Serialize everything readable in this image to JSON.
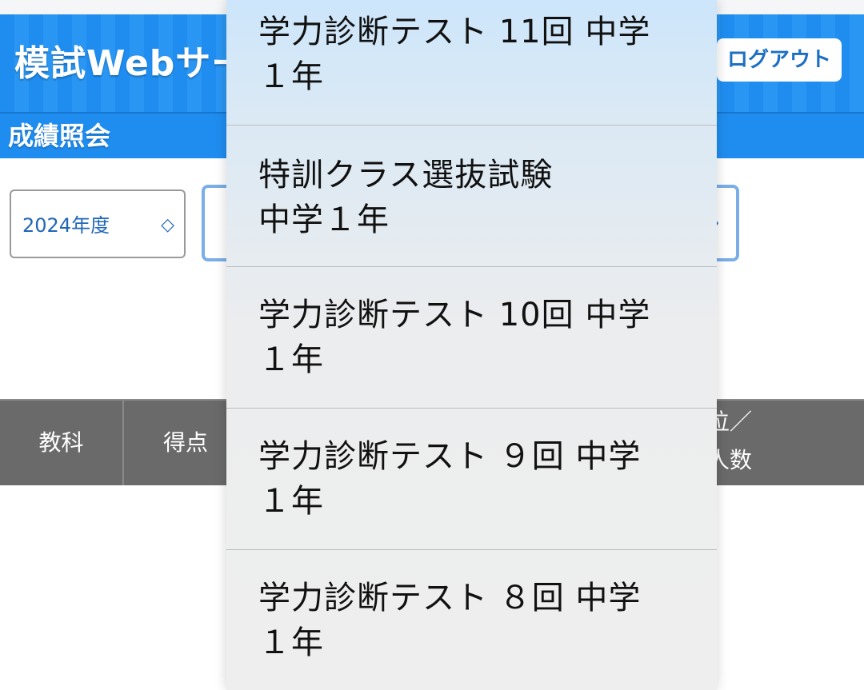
{
  "header": {
    "app_title": "模試Webサー",
    "logout_label": "ログアウト"
  },
  "subbar": {
    "title": "成績照会"
  },
  "filters": {
    "year_value": "2024年度",
    "year_chevron": "◇",
    "exam_chevron": "〉"
  },
  "table": {
    "headers": [
      {
        "label": "教科"
      },
      {
        "label": "得点"
      },
      {
        "line1": "位／",
        "line2": "人数"
      }
    ]
  },
  "dropdown": {
    "options": [
      {
        "line1": "学力診断テスト 11回 中学",
        "line2": "１年"
      },
      {
        "line1": "特訓クラス選抜試験",
        "line2": "中学１年"
      },
      {
        "line1": "学力診断テスト 10回 中学",
        "line2": "１年"
      },
      {
        "line1": "学力診断テスト ９回 中学",
        "line2": "１年"
      },
      {
        "line1": "学力診断テスト ８回 中学",
        "line2": "１年"
      }
    ]
  },
  "colors": {
    "header_blue": "#1f8df0",
    "link_blue": "#2067b8",
    "table_header_gray": "#6a6a6a"
  }
}
